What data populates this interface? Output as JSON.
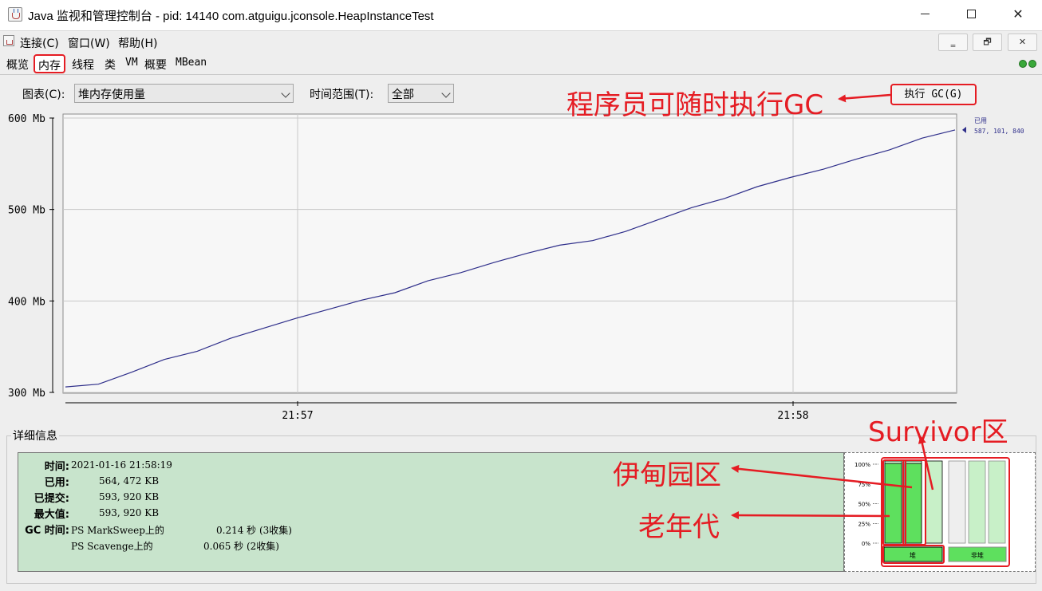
{
  "window": {
    "title": "Java 监视和管理控制台 - pid: 14140 com.atguigu.jconsole.HeapInstanceTest",
    "icon": "java-coffee-icon",
    "minimize": "minimize-icon",
    "maximize": "maximize-icon",
    "close": "close-icon",
    "close_glyph": "✕"
  },
  "menu": {
    "items": [
      "连接(C)",
      "窗口(W)",
      "帮助(H)"
    ],
    "mdi_buttons": [
      "‗",
      "🗗",
      "✕"
    ]
  },
  "tabs": [
    "概览",
    "内存",
    "线程",
    "类",
    "VM 概要",
    "MBean"
  ],
  "tab_labels": {
    "vm": "VM",
    "vm_summary": "概要"
  },
  "active_tab": "内存",
  "connection_icon": "connected-plug-icon",
  "controls": {
    "chart_label": "图表(C):",
    "chart_value": "堆内存使用量",
    "range_label": "时间范围(T):",
    "range_value": "全部",
    "gc_button": "执行 GC(G)"
  },
  "chart_data": {
    "type": "line",
    "ylim": [
      300,
      600
    ],
    "yticks": [
      "600 Mb",
      "500 Mb",
      "400 Mb",
      "300 Mb"
    ],
    "ytick_values": [
      600,
      500,
      400,
      300
    ],
    "xticks": [
      "21:57",
      "21:58"
    ],
    "series": [
      {
        "name": "已用",
        "value_label": "587, 101, 840",
        "color": "#2e2e8a",
        "values": [
          306,
          309,
          322,
          336,
          345,
          359,
          370,
          381,
          391,
          401,
          409,
          422,
          431,
          442,
          452,
          461,
          466,
          476,
          489,
          502,
          512,
          525,
          535,
          544,
          555,
          565,
          578,
          587
        ]
      }
    ],
    "grid": true
  },
  "details": {
    "title": "详细信息",
    "rows": [
      {
        "label": "时间:",
        "value": "2021-01-16 21:58:19"
      },
      {
        "label": "已用:",
        "value": "564, 472 KB"
      },
      {
        "label": "已提交:",
        "value": "593, 920 KB"
      },
      {
        "label": "最大值:",
        "value": "593, 920 KB"
      }
    ],
    "gc_label": "GC 时间:",
    "gc_rows": [
      {
        "name": "PS MarkSweep上的",
        "value": "0.214 秒 (3收集)"
      },
      {
        "name": "PS Scavenge上的",
        "value": "0.065 秒 (2收集)"
      }
    ]
  },
  "pools": {
    "yticks": [
      "100%",
      "75%",
      "50%",
      "25%",
      "0%"
    ],
    "heap_bars": [
      0.97,
      0.97,
      0.0
    ],
    "nonheap_bars": [
      0.0,
      0.0,
      0.0
    ],
    "heap_label": "堆",
    "nonheap_label": "非堆",
    "fill_color": "#5ee05e",
    "empty_color": "#c8f0c8"
  },
  "annotations": {
    "gc": "程序员可随时执行GC",
    "survivor": "Survivor区",
    "eden": "伊甸园区",
    "old": "老年代",
    "color": "#e51c23"
  }
}
